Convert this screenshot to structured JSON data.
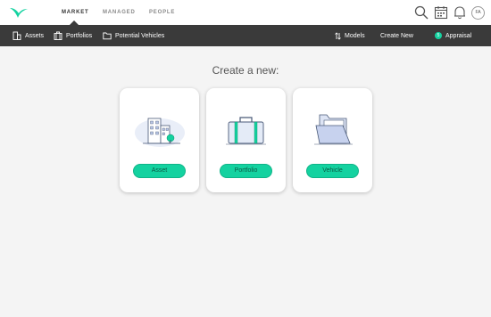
{
  "top_nav": {
    "tabs": [
      "MARKET",
      "MANAGED",
      "PEOPLE"
    ],
    "active_tab": "MARKET",
    "icons": [
      "search-icon",
      "calendar-icon",
      "bell-icon"
    ],
    "avatar_initials": "FA"
  },
  "sub_nav": {
    "left_items": [
      {
        "label": "Assets",
        "icon": "building-icon"
      },
      {
        "label": "Portfolios",
        "icon": "briefcase-icon"
      },
      {
        "label": "Potential Vehicles",
        "icon": "folder-icon"
      }
    ],
    "models_label": "Models",
    "create_new_label": "Create New",
    "appraisal_label": "Appraisal",
    "appraisal_badge": "5"
  },
  "main": {
    "heading": "Create a new:",
    "cards": [
      {
        "button_label": "Asset",
        "illustration": "building-illustration"
      },
      {
        "button_label": "Portfolio",
        "illustration": "briefcase-illustration"
      },
      {
        "button_label": "Vehicle",
        "illustration": "folder-illustration"
      }
    ]
  },
  "colors": {
    "accent": "#14d2a0",
    "subnav_bg": "#3a3a3a",
    "page_bg": "#f4f4f4"
  }
}
